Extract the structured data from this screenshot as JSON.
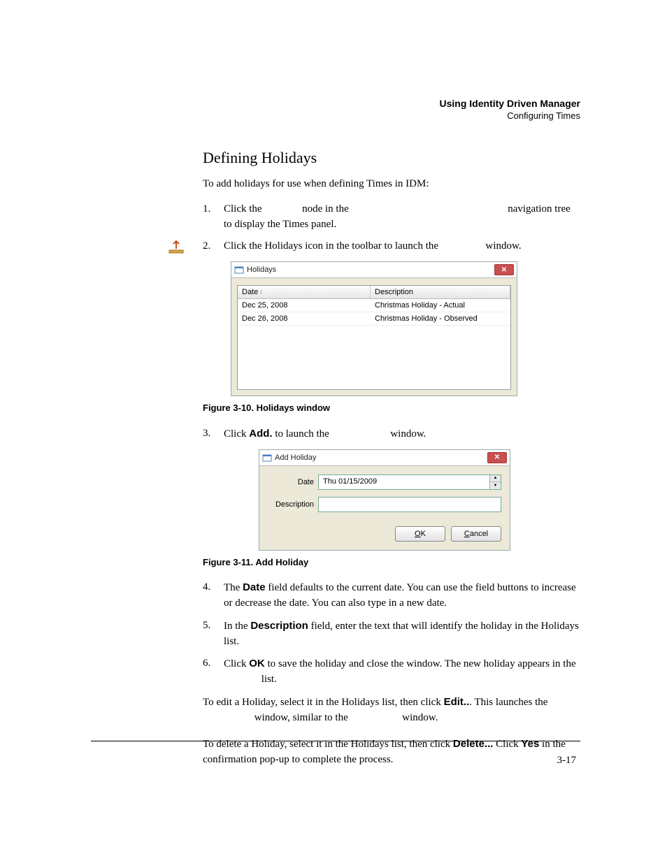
{
  "header": {
    "title": "Using Identity Driven Manager",
    "subtitle": "Configuring Times"
  },
  "section_title": "Defining Holidays",
  "intro": "To add holidays for use when defining Times in IDM:",
  "steps": {
    "s1": {
      "num": "1.",
      "a": "Click the",
      "b": "node in the",
      "c": "navigation tree to display the Times panel."
    },
    "s2": {
      "num": "2.",
      "a": "Click the Holidays icon in the toolbar to launch the",
      "b": "window."
    },
    "s3": {
      "num": "3.",
      "a": "Click ",
      "bold": "Add.",
      "b": " to launch the",
      "c": "window."
    },
    "s4": {
      "num": "4.",
      "a": "The ",
      "bold": "Date",
      "b": " field defaults to the current date. You can use the field buttons to increase or decrease the date. You can also type in a new date."
    },
    "s5": {
      "num": "5.",
      "a": "In the ",
      "bold": "Description",
      "b": " field, enter the text that will identify the holiday in the Holidays list."
    },
    "s6": {
      "num": "6.",
      "a": "Click ",
      "bold": "OK",
      "b": " to save the holiday and close the window. The new holiday appears in the",
      "c": "list."
    }
  },
  "holidays_window": {
    "title": "Holidays",
    "col_date": "Date",
    "col_desc": "Description",
    "rows": [
      {
        "date": "Dec 25, 2008",
        "desc": "Christmas Holiday - Actual"
      },
      {
        "date": "Dec 26, 2008",
        "desc": "Christmas Holiday - Observed"
      }
    ]
  },
  "fig10_caption": "Figure 3-10. Holidays window",
  "add_holiday_window": {
    "title": "Add Holiday",
    "date_label": "Date",
    "date_value": "Thu  01/15/2009",
    "desc_label": "Description",
    "ok": "OK",
    "cancel": "Cancel"
  },
  "fig11_caption": "Figure 3-11. Add Holiday",
  "edit_para": {
    "a": "To edit a Holiday, select it in the Holidays list, then click ",
    "bold": "Edit..",
    "b": ". This launches the",
    "c": "window, similar to the",
    "d": "window."
  },
  "delete_para": {
    "a": "To delete a Holiday, select it in the Holidays list, then click ",
    "bold1": "Delete...",
    "b": " Click ",
    "bold2": "Yes",
    "c": " in the confirmation pop-up to complete the process."
  },
  "page_num": "3-17"
}
